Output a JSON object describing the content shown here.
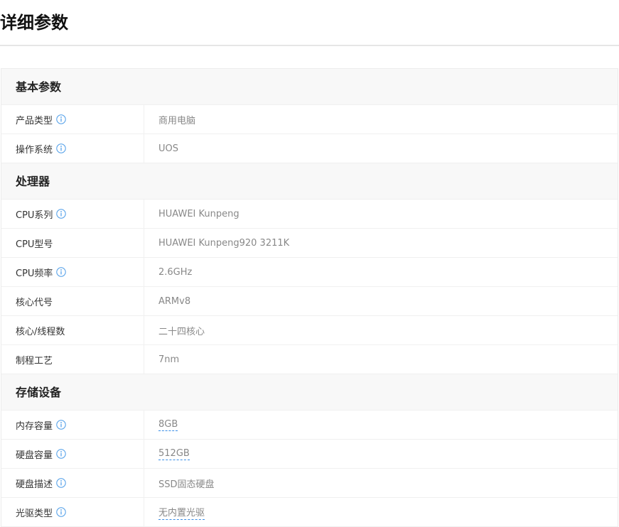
{
  "page": {
    "title": "详细参数"
  },
  "colors": {
    "info_icon": "#4a9be8",
    "value_link_underline": "#3a8ee6"
  },
  "sections": [
    {
      "title": "基本参数",
      "rows": [
        {
          "label": "产品类型",
          "value": "商用电脑",
          "info": true,
          "link": false
        },
        {
          "label": "操作系统",
          "value": "UOS",
          "info": true,
          "link": false
        }
      ]
    },
    {
      "title": "处理器",
      "rows": [
        {
          "label": "CPU系列",
          "value": "HUAWEI Kunpeng",
          "info": true,
          "link": false
        },
        {
          "label": "CPU型号",
          "value": "HUAWEI Kunpeng920 3211K",
          "info": false,
          "link": false
        },
        {
          "label": "CPU频率",
          "value": "2.6GHz",
          "info": true,
          "link": false
        },
        {
          "label": "核心代号",
          "value": "ARMv8",
          "info": false,
          "link": false
        },
        {
          "label": "核心/线程数",
          "value": "二十四核心",
          "info": false,
          "link": false
        },
        {
          "label": "制程工艺",
          "value": "7nm",
          "info": false,
          "link": false
        }
      ]
    },
    {
      "title": "存储设备",
      "rows": [
        {
          "label": "内存容量",
          "value": "8GB",
          "info": true,
          "link": true
        },
        {
          "label": "硬盘容量",
          "value": "512GB",
          "info": true,
          "link": true
        },
        {
          "label": "硬盘描述",
          "value": "SSD固态硬盘",
          "info": true,
          "link": false
        },
        {
          "label": "光驱类型",
          "value": "无内置光驱",
          "info": true,
          "link": true
        }
      ]
    }
  ]
}
